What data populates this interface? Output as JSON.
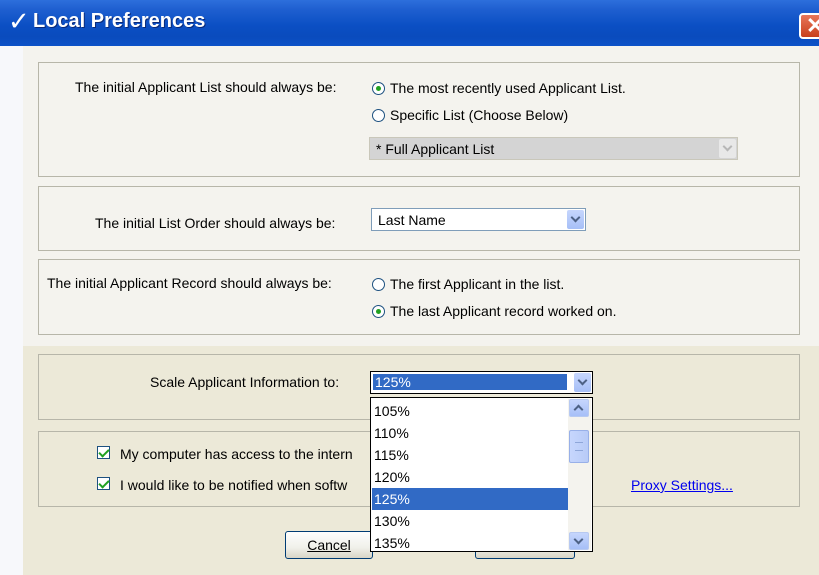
{
  "window": {
    "title": "Local Preferences"
  },
  "applicant_list": {
    "label": "The initial Applicant List should always be:",
    "option_recent": "The most recently used Applicant List.",
    "option_specific": "Specific List (Choose Below)",
    "specific_list_value": "* Full Applicant List"
  },
  "list_order": {
    "label": "The initial List Order should always be:",
    "value": "Last Name"
  },
  "applicant_record": {
    "label": "The initial Applicant Record should always be:",
    "option_first": "The first Applicant in the list.",
    "option_last": "The last Applicant record worked on."
  },
  "scale": {
    "label": "Scale Applicant Information to:",
    "value": "125%",
    "options": [
      "105%",
      "110%",
      "115%",
      "120%",
      "125%",
      "130%",
      "135%"
    ],
    "selected_index": 4
  },
  "internet": {
    "access_label": "My computer has access to the intern",
    "notify_label": "I would like to be notified when softw",
    "proxy_link": "Proxy Settings..."
  },
  "buttons": {
    "cancel": "Cancel"
  },
  "colors": {
    "title_blue": "#0a4bbd",
    "selection": "#316ac5",
    "check_green": "#21a121"
  }
}
